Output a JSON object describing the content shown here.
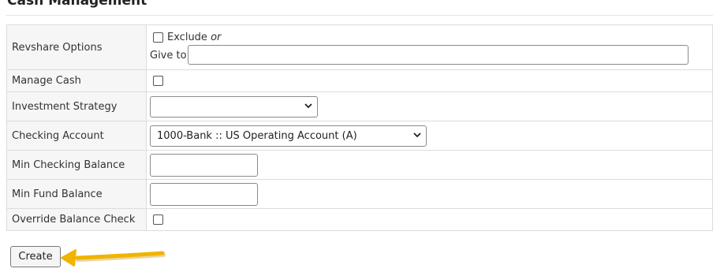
{
  "section": {
    "title": "Cash Management"
  },
  "form": {
    "revshare": {
      "label": "Revshare Options",
      "exclude_label": "Exclude",
      "or_text": "or",
      "give_to_label": "Give to",
      "give_to_value": ""
    },
    "manage_cash": {
      "label": "Manage Cash",
      "checked": false
    },
    "investment_strategy": {
      "label": "Investment Strategy",
      "selected": ""
    },
    "checking_account": {
      "label": "Checking Account",
      "selected": "1000-Bank :: US Operating Account (A)"
    },
    "min_checking_balance": {
      "label": "Min Checking Balance",
      "value": ""
    },
    "min_fund_balance": {
      "label": "Min Fund Balance",
      "value": ""
    },
    "override_balance_check": {
      "label": "Override Balance Check",
      "checked": false
    }
  },
  "actions": {
    "create_label": "Create"
  },
  "colors": {
    "annotation_arrow": "#f0b400",
    "label_cell_bg": "#f6f6f6",
    "border": "#dcdcdc"
  },
  "icons": {
    "select_arrow": "chevron-down-icon",
    "annotation": "arrow-annotation-icon"
  }
}
